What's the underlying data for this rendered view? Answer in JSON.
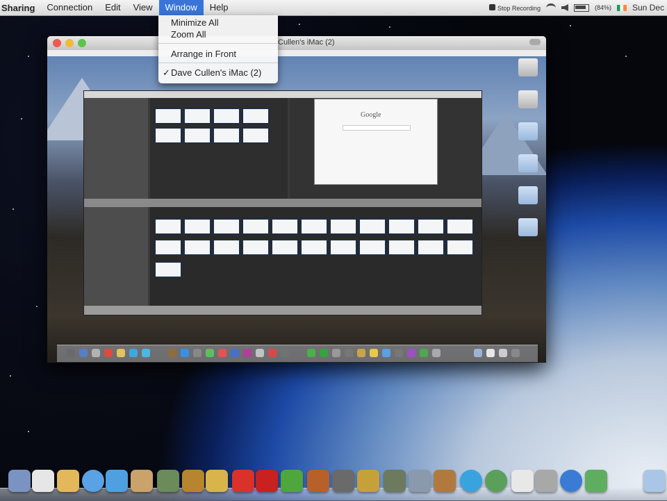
{
  "menubar": {
    "app_name": "Sharing",
    "items": [
      {
        "label": "Connection",
        "active": false
      },
      {
        "label": "Edit",
        "active": false
      },
      {
        "label": "View",
        "active": false
      },
      {
        "label": "Window",
        "active": true
      },
      {
        "label": "Help",
        "active": false
      }
    ],
    "status": {
      "stop_recording": "Stop Recording",
      "battery": "(84%)",
      "clock": "Sun Dec"
    }
  },
  "window_menu": {
    "items": [
      "Minimize All",
      "Zoom All",
      "Arrange in Front",
      "Dave Cullen's iMac (2)"
    ],
    "checked_item": "Dave Cullen's iMac (2)"
  },
  "remote_window": {
    "title": "Cullen's iMac (2)",
    "google_logo": "Google"
  },
  "colors": {
    "menu_highlight": "#3a74d8",
    "close": "#ee5a52",
    "minimize": "#f2b83c",
    "zoom": "#5fc24c"
  },
  "dock_icons": [
    "preview-icon",
    "ical-icon",
    "notes-icon",
    "safari-icon",
    "itunes-icon",
    "photo-icon",
    "network-icon",
    "garageband-icon",
    "pencil-icon",
    "red-book-icon",
    "red-app-icon",
    "utorrent-icon",
    "quake-icon",
    "disk-icon",
    "game-icon",
    "screen-icon",
    "grid-icon",
    "bag-icon",
    "skype-icon",
    "globe-icon",
    "paper-icon",
    "utility-icon",
    "quicktime-icon",
    "chart-icon",
    "folder-icon"
  ]
}
